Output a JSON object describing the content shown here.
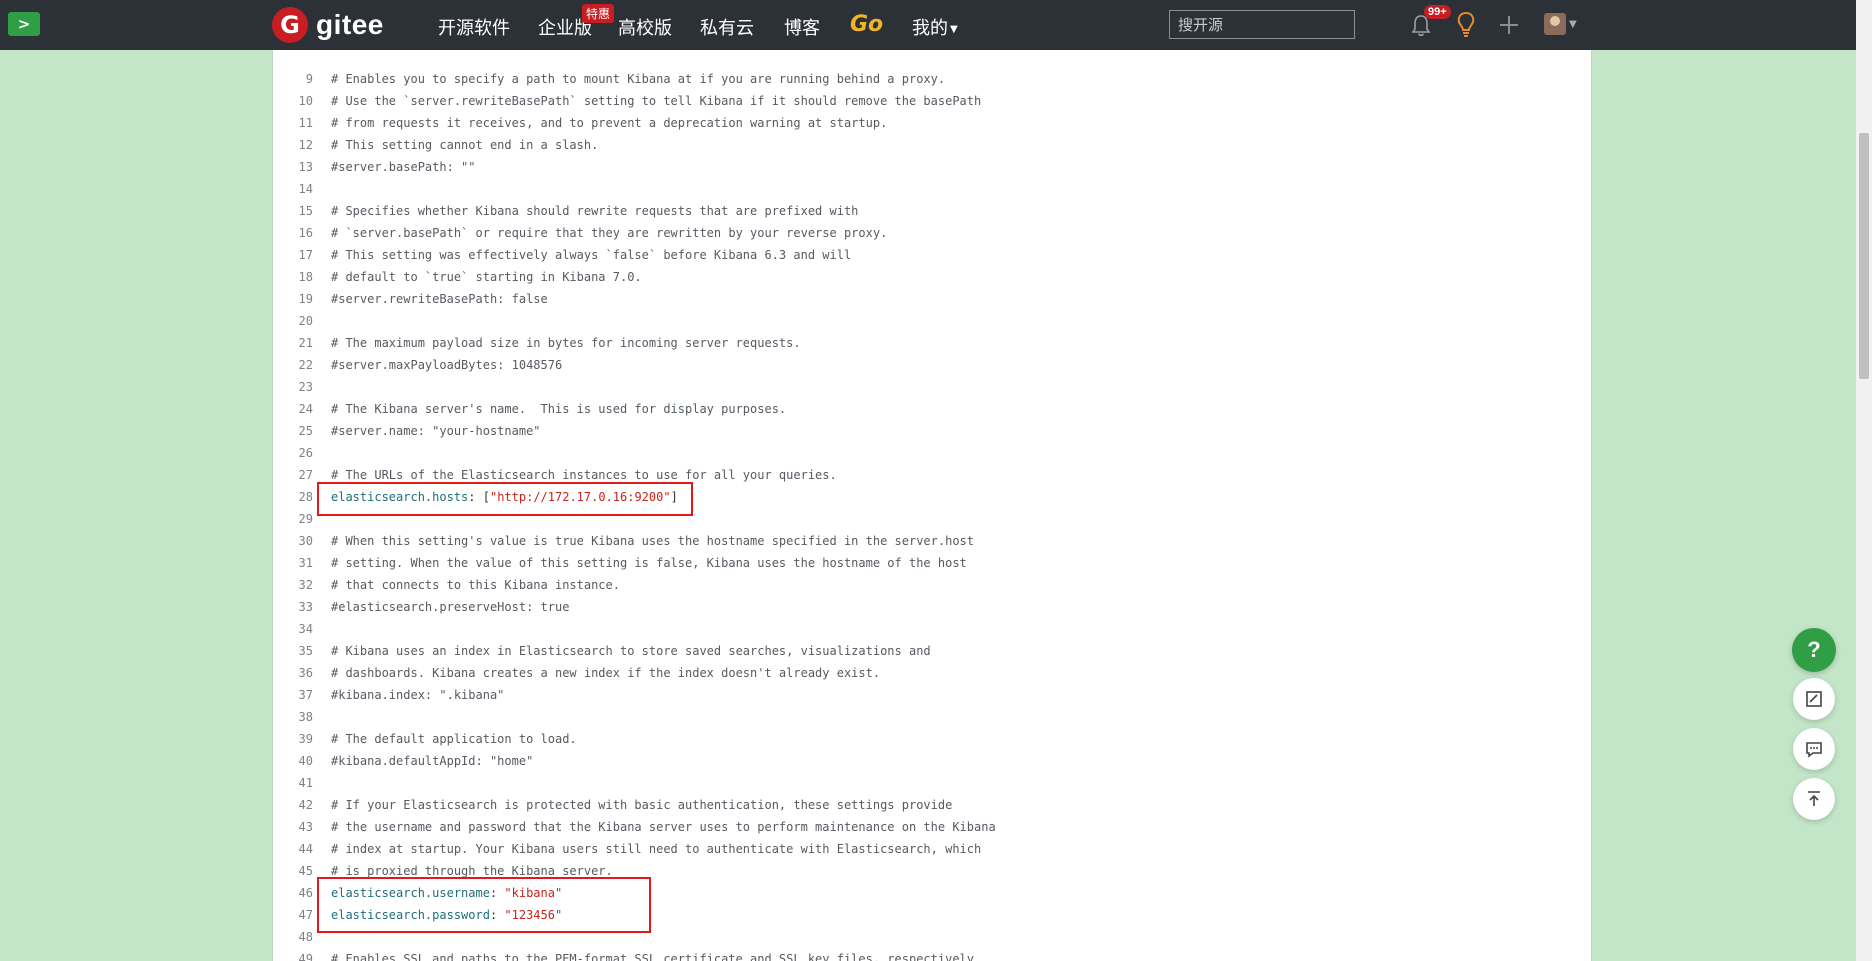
{
  "nav": {
    "logo_letter": "G",
    "logo_text": "gitee",
    "items": [
      "开源软件",
      "企业版",
      "高校版",
      "私有云",
      "博客",
      "Go",
      "我的"
    ],
    "enterprise_badge": "特惠",
    "search_placeholder": "搜开源",
    "notification_count": "99+"
  },
  "code": {
    "lines": [
      {
        "n": "9",
        "t": "# Enables you to specify a path to mount Kibana at if you are running behind a proxy.",
        "k": "comment"
      },
      {
        "n": "10",
        "t": "# Use the `server.rewriteBasePath` setting to tell Kibana if it should remove the basePath",
        "k": "comment"
      },
      {
        "n": "11",
        "t": "# from requests it receives, and to prevent a deprecation warning at startup.",
        "k": "comment"
      },
      {
        "n": "12",
        "t": "# This setting cannot end in a slash.",
        "k": "comment"
      },
      {
        "n": "13",
        "t": "#server.basePath: \"\"",
        "k": "comment"
      },
      {
        "n": "14",
        "t": "",
        "k": "comment"
      },
      {
        "n": "15",
        "t": "# Specifies whether Kibana should rewrite requests that are prefixed with",
        "k": "comment"
      },
      {
        "n": "16",
        "t": "# `server.basePath` or require that they are rewritten by your reverse proxy.",
        "k": "comment"
      },
      {
        "n": "17",
        "t": "# This setting was effectively always `false` before Kibana 6.3 and will",
        "k": "comment"
      },
      {
        "n": "18",
        "t": "# default to `true` starting in Kibana 7.0.",
        "k": "comment"
      },
      {
        "n": "19",
        "t": "#server.rewriteBasePath: false",
        "k": "comment"
      },
      {
        "n": "20",
        "t": "",
        "k": "comment"
      },
      {
        "n": "21",
        "t": "# The maximum payload size in bytes for incoming server requests.",
        "k": "comment"
      },
      {
        "n": "22",
        "t": "#server.maxPayloadBytes: 1048576",
        "k": "comment"
      },
      {
        "n": "23",
        "t": "",
        "k": "comment"
      },
      {
        "n": "24",
        "t": "# The Kibana server's name.  This is used for display purposes.",
        "k": "comment"
      },
      {
        "n": "25",
        "t": "#server.name: \"your-hostname\"",
        "k": "comment"
      },
      {
        "n": "26",
        "t": "",
        "k": "comment"
      },
      {
        "n": "27",
        "t": "# The URLs of the Elasticsearch instances to use for all your queries.",
        "k": "comment"
      },
      {
        "n": "28",
        "k": "config",
        "key": "elasticsearch.hosts",
        "sep": ": [",
        "val": "\"http://172.17.0.16:9200\"",
        "end": "]"
      },
      {
        "n": "29",
        "t": "",
        "k": "comment"
      },
      {
        "n": "30",
        "t": "# When this setting's value is true Kibana uses the hostname specified in the server.host",
        "k": "comment"
      },
      {
        "n": "31",
        "t": "# setting. When the value of this setting is false, Kibana uses the hostname of the host",
        "k": "comment"
      },
      {
        "n": "32",
        "t": "# that connects to this Kibana instance.",
        "k": "comment"
      },
      {
        "n": "33",
        "t": "#elasticsearch.preserveHost: true",
        "k": "comment"
      },
      {
        "n": "34",
        "t": "",
        "k": "comment"
      },
      {
        "n": "35",
        "t": "# Kibana uses an index in Elasticsearch to store saved searches, visualizations and",
        "k": "comment"
      },
      {
        "n": "36",
        "t": "# dashboards. Kibana creates a new index if the index doesn't already exist.",
        "k": "comment"
      },
      {
        "n": "37",
        "t": "#kibana.index: \".kibana\"",
        "k": "comment"
      },
      {
        "n": "38",
        "t": "",
        "k": "comment"
      },
      {
        "n": "39",
        "t": "# The default application to load.",
        "k": "comment"
      },
      {
        "n": "40",
        "t": "#kibana.defaultAppId: \"home\"",
        "k": "comment"
      },
      {
        "n": "41",
        "t": "",
        "k": "comment"
      },
      {
        "n": "42",
        "t": "# If your Elasticsearch is protected with basic authentication, these settings provide",
        "k": "comment"
      },
      {
        "n": "43",
        "t": "# the username and password that the Kibana server uses to perform maintenance on the Kibana",
        "k": "comment"
      },
      {
        "n": "44",
        "t": "# index at startup. Your Kibana users still need to authenticate with Elasticsearch, which",
        "k": "comment"
      },
      {
        "n": "45",
        "t": "# is proxied through the Kibana server.",
        "k": "comment"
      },
      {
        "n": "46",
        "k": "config",
        "key": "elasticsearch.username",
        "sep": ": ",
        "val": "\"kibana\"",
        "end": ""
      },
      {
        "n": "47",
        "k": "config",
        "key": "elasticsearch.password",
        "sep": ": ",
        "val": "\"123456\"",
        "end": ""
      },
      {
        "n": "48",
        "t": "",
        "k": "comment"
      },
      {
        "n": "49",
        "t": "# Enables SSL and paths to the PEM-format SSL certificate and SSL key files, respectively.",
        "k": "comment"
      }
    ]
  },
  "floating": {
    "help_label": "?"
  },
  "colors": {
    "brand_red": "#c71d23",
    "gitee_green": "#2f9e44",
    "highlight_box": "#e11b1b"
  }
}
